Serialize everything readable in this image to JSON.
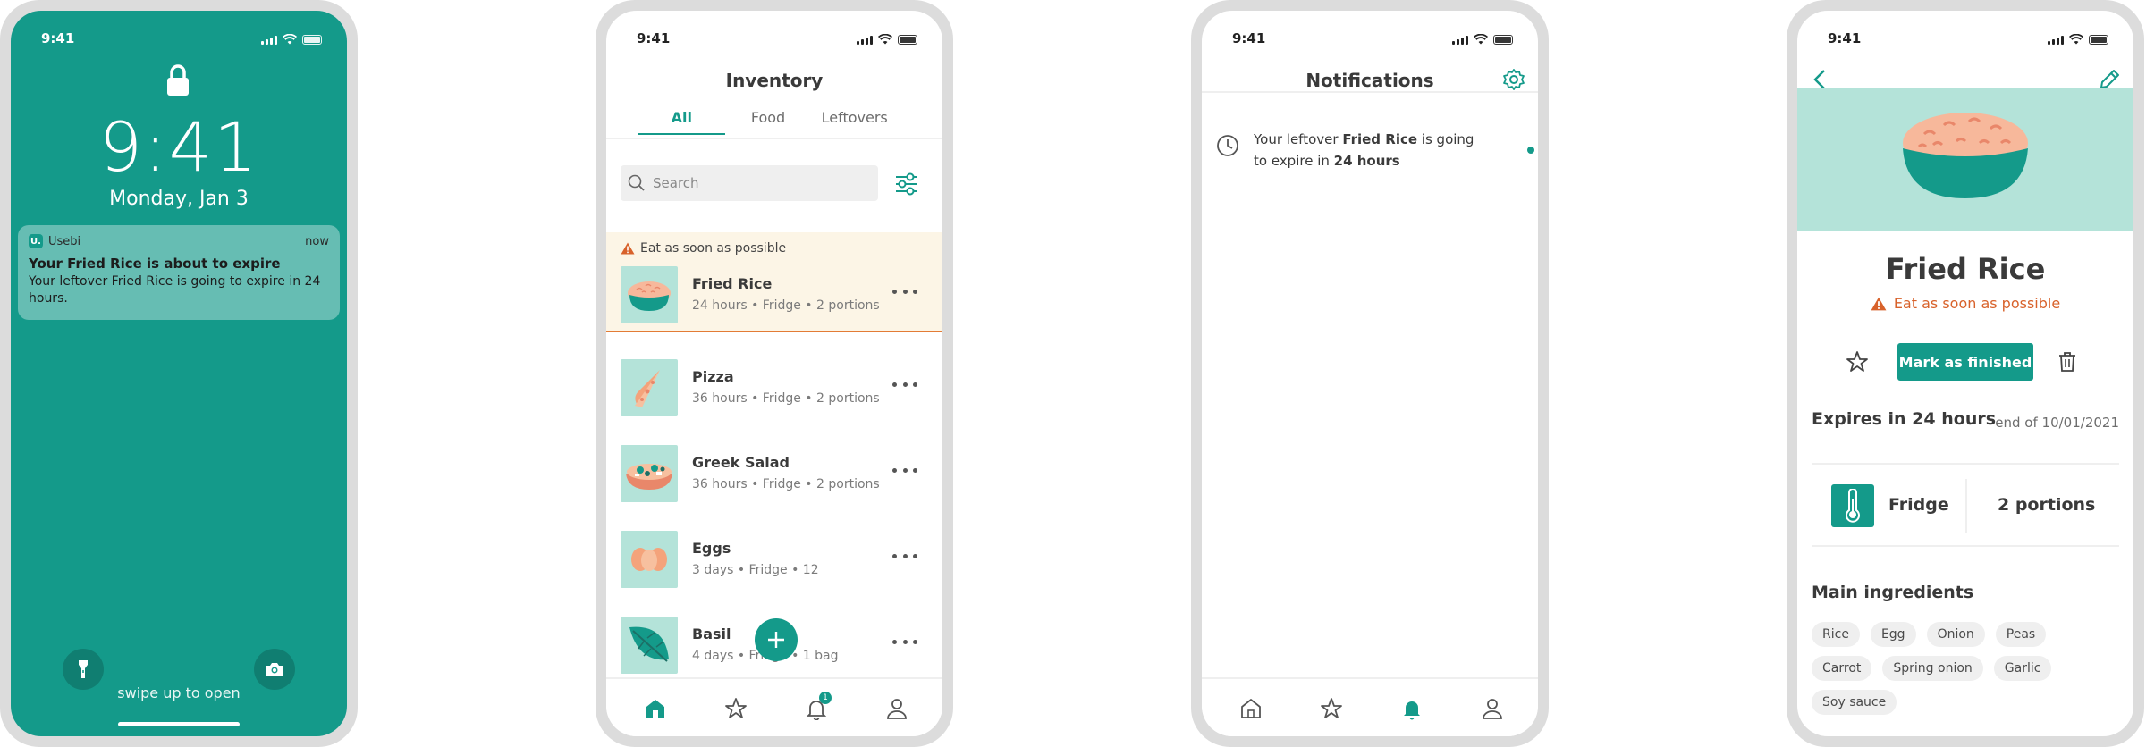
{
  "status_time": "9:41",
  "lock": {
    "time": "9:41",
    "date": "Monday, Jan 3",
    "notification": {
      "app_initial": "U.",
      "app_name": "Usebi",
      "time": "now",
      "title": "Your Fried Rice is about to expire",
      "body": "Your leftover Fried Rice is going to expire in 24 hours."
    },
    "swipe_text": "swipe up to open"
  },
  "inventory": {
    "title": "Inventory",
    "tabs": [
      {
        "label": "All",
        "active": true
      },
      {
        "label": "Food",
        "active": false
      },
      {
        "label": "Leftovers",
        "active": false
      }
    ],
    "search_placeholder": "Search",
    "alert_label": "Eat as soon as possible",
    "items": [
      {
        "name": "Fried Rice",
        "meta": "24 hours • Fridge • 2 portions"
      },
      {
        "name": "Pizza",
        "meta": "36 hours • Fridge • 2 portions"
      },
      {
        "name": "Greek Salad",
        "meta": "36 hours • Fridge • 2 portions"
      },
      {
        "name": "Eggs",
        "meta": "3 days • Fridge • 12"
      },
      {
        "name": "Basil",
        "meta": "4 days • Fridge • 1 bag"
      }
    ],
    "notification_badge": "1"
  },
  "notifications": {
    "title": "Notifications",
    "items": [
      {
        "prefix": "Your leftover ",
        "bold1": "Fried Rice",
        "middle": " is going to expire in ",
        "bold2": "24 hours"
      }
    ]
  },
  "detail": {
    "title": "Fried Rice",
    "alert_label": "Eat as soon as possible",
    "mark_button": "Mark as finished",
    "expires_label": "Expires in 24 hours",
    "expires_date": "end of 10/01/2021",
    "storage": "Fridge",
    "portions": "2 portions",
    "ingredients_title": "Main ingredients",
    "ingredients": [
      "Rice",
      "Egg",
      "Onion",
      "Peas",
      "Carrot",
      "Spring onion",
      "Garlic",
      "Soy sauce"
    ]
  },
  "colors": {
    "brand": "#149a8a",
    "mint": "#b4e3d9",
    "warning": "#d8622b",
    "alert_bg": "#fcf5e6"
  }
}
